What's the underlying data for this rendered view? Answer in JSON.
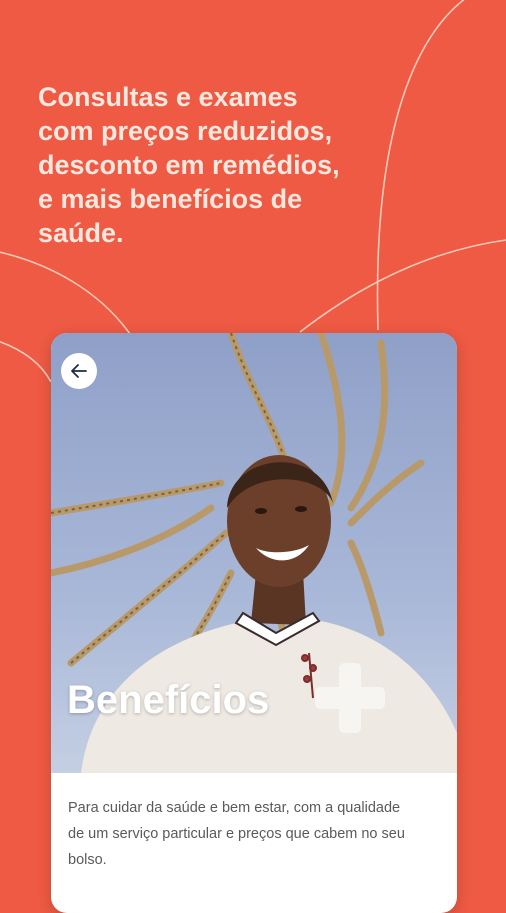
{
  "headline": {
    "lines": [
      "Consultas e exames",
      "com preços reduzidos,",
      "desconto em remédios,",
      "e mais benefícios de",
      "saúde."
    ]
  },
  "card": {
    "title": "Benefícios",
    "description": "Para cuidar da saúde e bem estar, com a qualidade de um serviço particular e preços que cabem no seu bolso."
  },
  "colors": {
    "background": "#EE5A43",
    "headline": "#FBE7DE",
    "card": "#FFFFFF",
    "sky": "#A9B8D8"
  },
  "icons": {
    "back": "arrow-left-icon",
    "plus": "plus-icon"
  }
}
